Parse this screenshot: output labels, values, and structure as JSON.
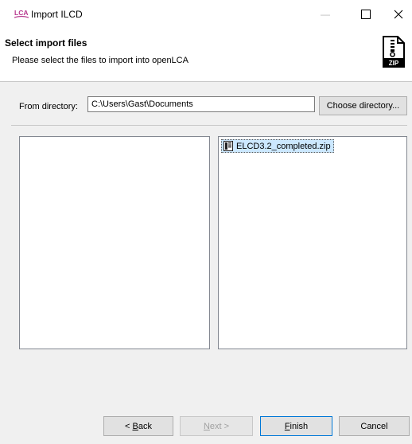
{
  "window": {
    "app_icon_text": "LCA",
    "title": "Import ILCD",
    "minimize_glyph": "—",
    "maximize_glyph": "☐",
    "close_glyph": "✕"
  },
  "header": {
    "title": "Select import files",
    "subtitle": "Please select the files to import into openLCA",
    "icon": "zip-file-icon",
    "icon_text": "ZIP"
  },
  "form": {
    "from_directory_label": "From directory:",
    "directory_value": "C:\\Users\\Gast\\Documents",
    "choose_directory_label": "Choose directory..."
  },
  "left_panel": {
    "items": []
  },
  "right_panel": {
    "items": [
      {
        "name": "ELCD3.2_completed.zip",
        "icon": "zip-file-icon",
        "selected": true
      }
    ]
  },
  "buttons": {
    "back": {
      "prefix": "< ",
      "mnemonic": "B",
      "rest": "ack",
      "enabled": true
    },
    "next": {
      "mnemonic": "N",
      "rest": "ext >",
      "enabled": false
    },
    "finish": {
      "mnemonic": "F",
      "rest": "inish",
      "enabled": true,
      "default": true
    },
    "cancel": {
      "label": "Cancel",
      "enabled": true
    }
  },
  "colors": {
    "accent": "#0078d7",
    "selection": "#cce8ff",
    "app_icon": "#b83a8f"
  }
}
